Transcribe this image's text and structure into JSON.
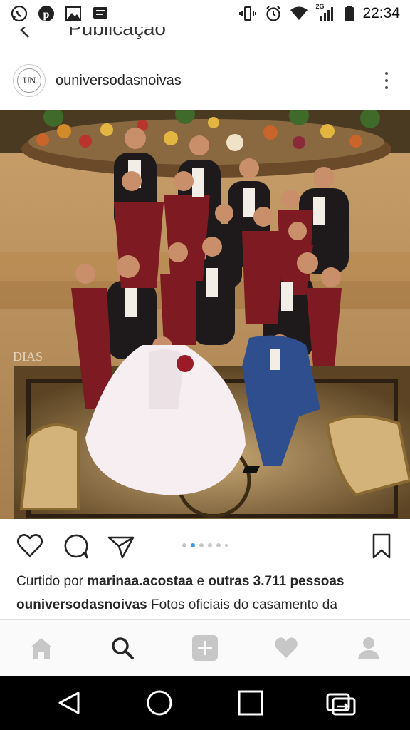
{
  "status_bar": {
    "left_icons": [
      "whatsapp-icon",
      "pinterest-icon",
      "image-icon",
      "message-icon"
    ],
    "right_icons": [
      "vibrate-icon",
      "alarm-icon",
      "wifi-icon",
      "signal-icon",
      "battery-icon"
    ],
    "network_label": "2G",
    "time": "22:34"
  },
  "header": {
    "title": "Publicação"
  },
  "post": {
    "avatar_text": "UN",
    "username": "ouniversodasnoivas",
    "photo_watermark": "DIAS",
    "carousel": {
      "count": 6,
      "active_index": 1
    },
    "likes": {
      "prefix": "Curtido por ",
      "user": "marinaa.acostaa",
      "middle": " e ",
      "others": "outras 3.711 pessoas"
    },
    "caption": {
      "user": "ouniversodasnoivas",
      "text": " Fotos oficiais do casamento  da"
    }
  },
  "bottom_nav": [
    "home-icon",
    "search-icon",
    "add-icon",
    "heart-icon",
    "profile-icon"
  ],
  "colors": {
    "like_blue": "#3897f0",
    "text": "#262626",
    "nav_inactive": "#c7c7c7"
  }
}
